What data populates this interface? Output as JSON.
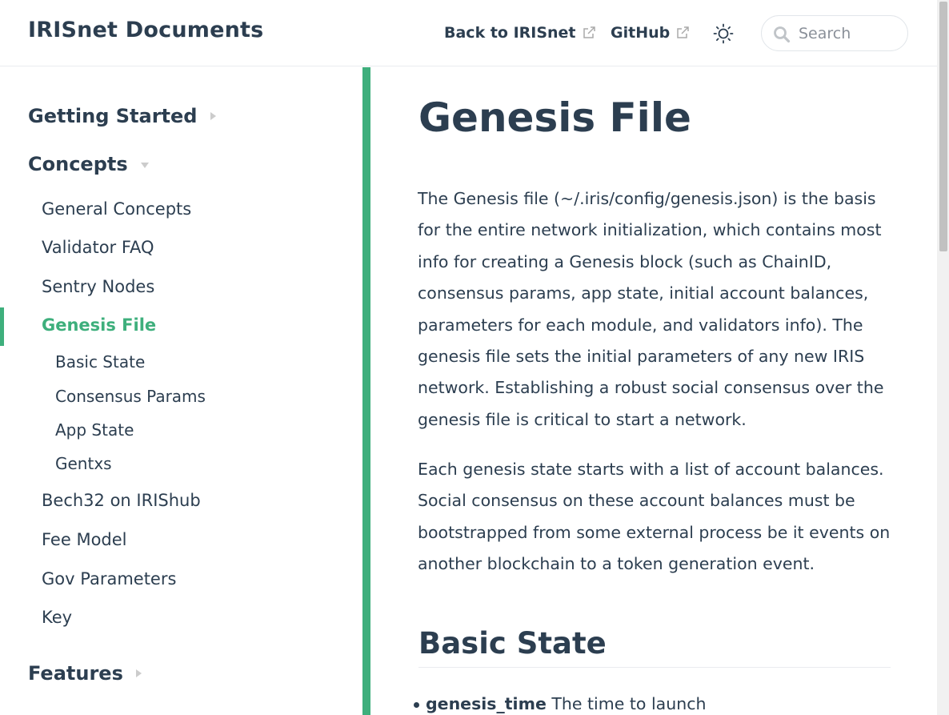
{
  "navbar": {
    "site_title": "IRISnet Documents",
    "links": [
      {
        "label": "Back to IRISnet",
        "icon": "external-link-icon"
      },
      {
        "label": "GitHub",
        "icon": "external-link-icon"
      }
    ],
    "theme_icon": "sun-icon",
    "search": {
      "placeholder": "Search",
      "value": ""
    }
  },
  "sidebar": {
    "groups": [
      {
        "title": "Getting Started",
        "expanded": false
      },
      {
        "title": "Concepts",
        "expanded": true
      },
      {
        "title": "Features",
        "expanded": false
      }
    ],
    "concepts_items": [
      "General Concepts",
      "Validator FAQ",
      "Sentry Nodes",
      "Genesis File",
      "Bech32 on IRIShub",
      "Fee Model",
      "Gov Parameters",
      "Key"
    ],
    "active_item": "Genesis File",
    "sub_items": [
      "Basic State",
      "Consensus Params",
      "App State",
      "Gentxs"
    ]
  },
  "content": {
    "title": "Genesis File",
    "paragraph1": "The Genesis file (~/.iris/config/genesis.json) is the basis for the entire network initialization, which contains most info for creating a Genesis block (such as ChainID, consensus params, app state, initial account balances, parameters for each module, and validators info). The genesis file sets the initial parameters of any new IRIS network. Establishing a robust social consensus over the genesis file is critical to start a network.",
    "paragraph2": "Each genesis state starts with a list of account balances. Social consensus on these account balances must be bootstrapped from some external process be it events on another blockchain to a token generation event.",
    "section_heading": "Basic State",
    "list": [
      {
        "term": "genesis_time",
        "text": " The time to launch"
      }
    ]
  },
  "colors": {
    "accent": "#3eaf7c",
    "text": "#2c3e50",
    "border": "#eaecef"
  }
}
